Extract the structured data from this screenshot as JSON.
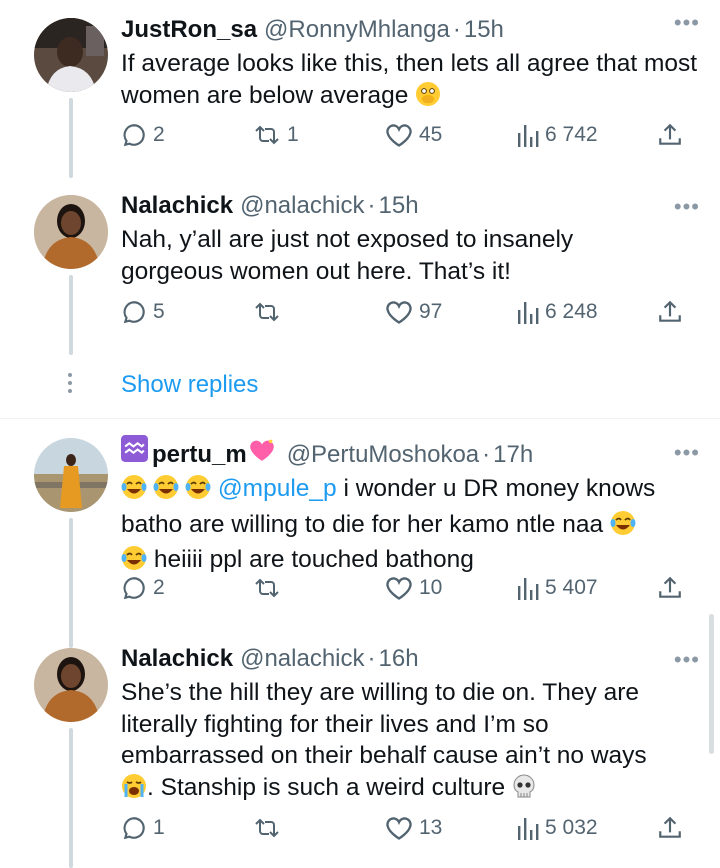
{
  "tweets": [
    {
      "name": "JustRon_sa",
      "handle": "@RonnyMhlanga",
      "time": "15h",
      "text": "If average looks like this, then lets all agree that most women are below average",
      "emoji_end": "face-with-open-eyes-and-hand-over-mouth",
      "replies": "2",
      "retweets": "1",
      "likes": "45",
      "views": "6 742"
    },
    {
      "name": "Nalachick",
      "handle": "@nalachick",
      "time": "15h",
      "text": "Nah, y’all are just not exposed to insanely gorgeous women out here. That’s it!",
      "replies": "5",
      "retweets": "",
      "likes": "97",
      "views": "6 248"
    },
    {
      "name": "pertu_m",
      "handle": "@PertuMoshokoa",
      "time": "17h",
      "mention": "@mpule_p",
      "text_line1_rest": "i wonder u DR money knows",
      "text_line2": "batho are willing to die for her kamo ntle naa",
      "text_line3": "heiiii ppl are touched bathong",
      "replies": "2",
      "retweets": "",
      "likes": "10",
      "views": "5 407"
    },
    {
      "name": "Nalachick",
      "handle": "@nalachick",
      "time": "16h",
      "text_line1": "She’s the hill they are willing to die on. They are",
      "text_line2": "literally fighting for their lives and I’m so",
      "text_line3": "embarrassed on their behalf cause ain’t no ways",
      "text_line4": ". Stanship is such a weird culture",
      "replies": "1",
      "retweets": "",
      "likes": "13",
      "views": "5 032"
    }
  ],
  "show_replies": "Show replies",
  "dot": "·",
  "more": "•••",
  "colors": {
    "accent": "#1d9bf0",
    "secondary": "#536471",
    "text": "#0f1419",
    "line": "#cfd9de"
  }
}
